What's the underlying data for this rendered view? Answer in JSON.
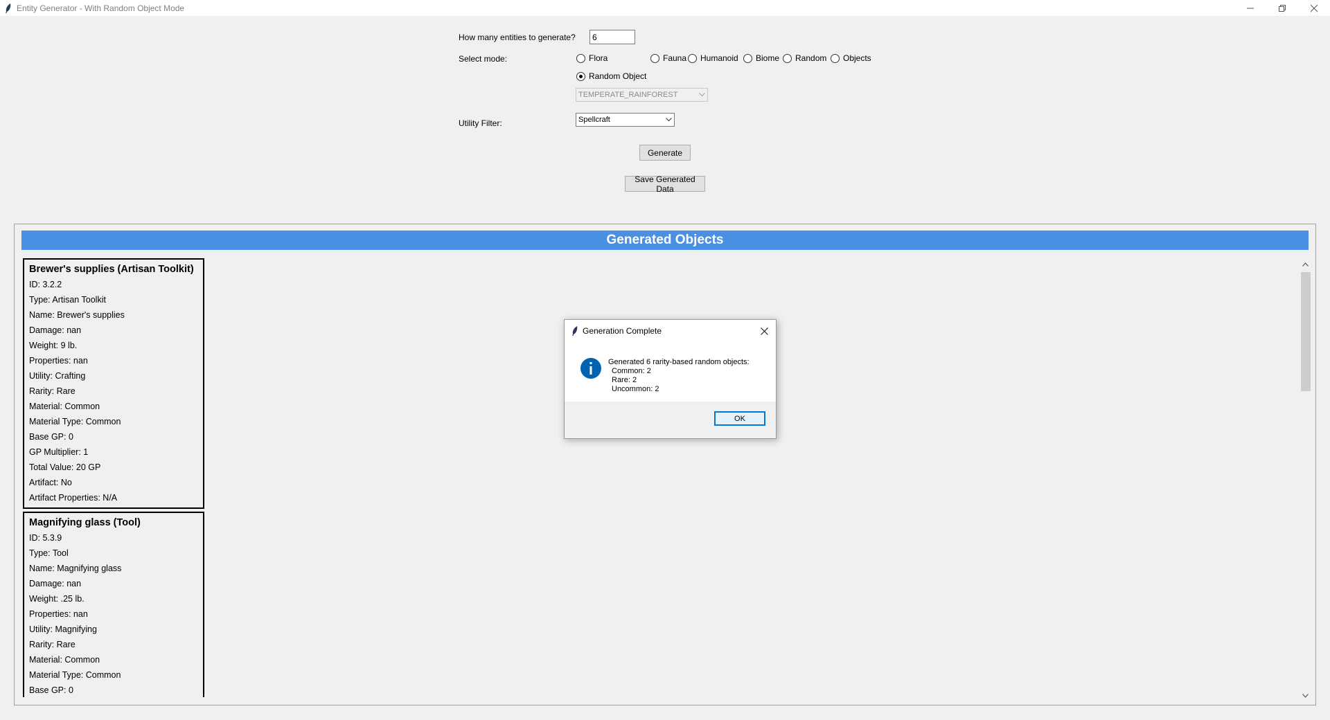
{
  "window": {
    "title": "Entity Generator - With Random Object Mode"
  },
  "form": {
    "count_label": "How many entities to generate?",
    "count_value": "6",
    "mode_label": "Select mode:",
    "modes": [
      {
        "label": "Flora",
        "selected": false
      },
      {
        "label": "Fauna",
        "selected": false
      },
      {
        "label": "Humanoid",
        "selected": false
      },
      {
        "label": "Biome",
        "selected": false
      },
      {
        "label": "Random",
        "selected": false
      },
      {
        "label": "Objects",
        "selected": false
      },
      {
        "label": "Random Object",
        "selected": true
      }
    ],
    "biome_select_value": "TEMPERATE_RAINFOREST",
    "utility_label": "Utility Filter:",
    "utility_value": "Spellcraft",
    "generate_label": "Generate",
    "save_label": "Save Generated Data"
  },
  "output": {
    "header": "Generated Objects",
    "cards": [
      {
        "title": "Brewer's supplies (Artisan Toolkit)",
        "fields": [
          "ID: 3.2.2",
          "Type: Artisan Toolkit",
          "Name: Brewer's supplies",
          "Damage: nan",
          "Weight: 9 lb.",
          "Properties: nan",
          "Utility: Crafting",
          "Rarity: Rare",
          "Material: Common",
          "Material Type: Common",
          "Base GP: 0",
          "GP Multiplier: 1",
          "Total Value: 20 GP",
          "Artifact: No",
          "Artifact Properties: N/A"
        ]
      },
      {
        "title": "Magnifying glass (Tool)",
        "fields": [
          "ID: 5.3.9",
          "Type: Tool",
          "Name: Magnifying glass",
          "Damage: nan",
          "Weight: .25 lb.",
          "Properties: nan",
          "Utility: Magnifying",
          "Rarity: Rare",
          "Material: Common",
          "Material Type: Common",
          "Base GP: 0"
        ]
      }
    ]
  },
  "dialog": {
    "title": "Generation Complete",
    "message_lines": [
      "Generated 6 rarity-based random objects:",
      "Common: 2",
      "Rare: 2",
      "Uncommon: 2"
    ],
    "ok_label": "OK",
    "icon": "info-icon",
    "accent_color": "#0063b1"
  },
  "colors": {
    "header_bg": "#4a90e2",
    "focus_border": "#0078d7"
  }
}
